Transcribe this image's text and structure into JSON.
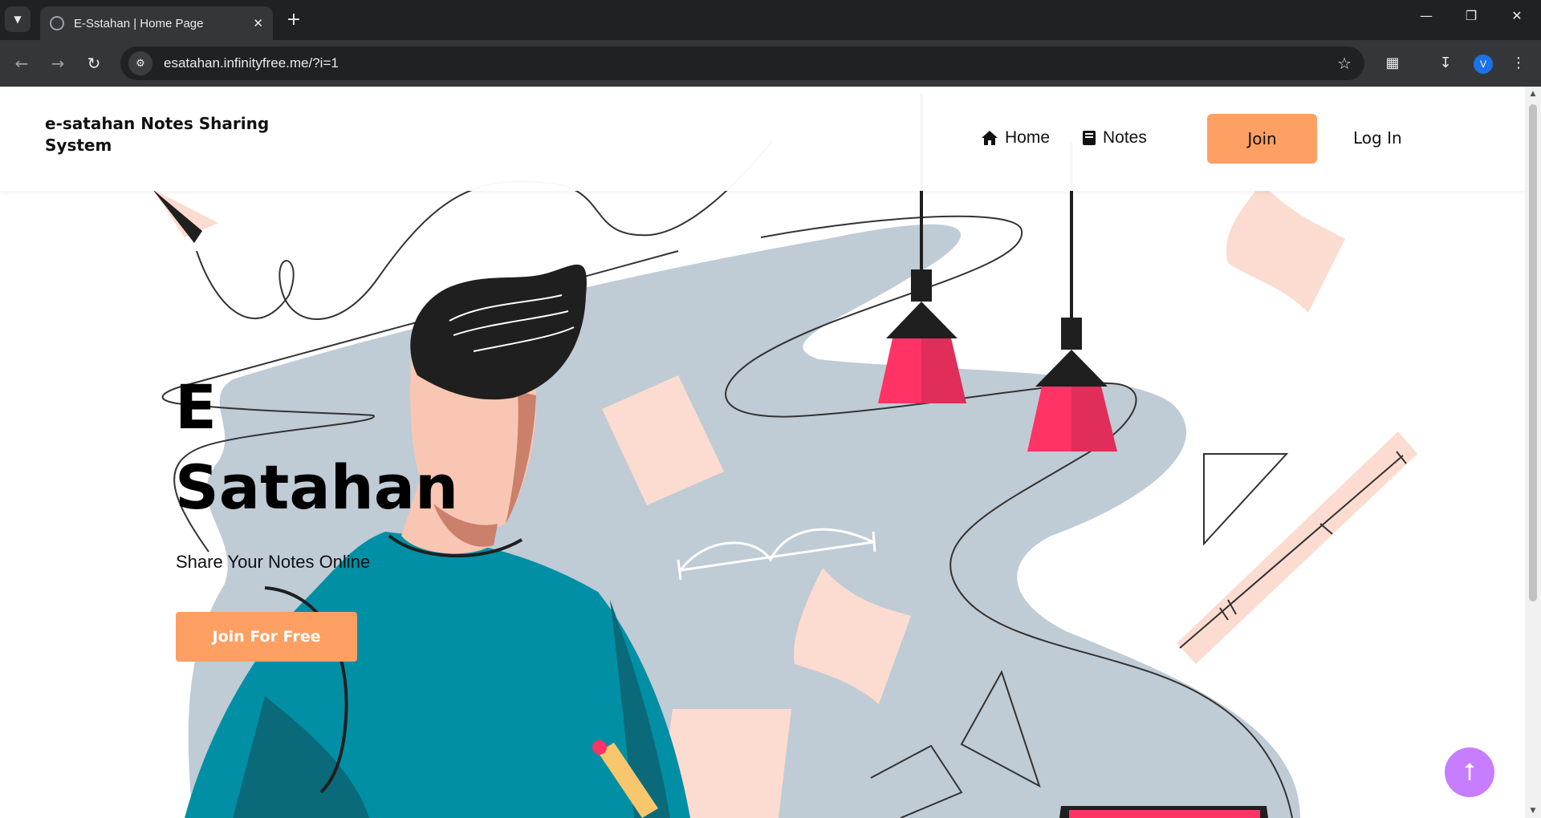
{
  "browser": {
    "tab_title": "E-Sstahan | Home Page",
    "url": "esatahan.infinityfree.me/?i=1",
    "profile_initial": "V"
  },
  "header": {
    "brand": "e-satahan Notes Sharing System",
    "nav": [
      {
        "label": "Home",
        "icon": "home-icon"
      },
      {
        "label": "Notes",
        "icon": "book-icon"
      }
    ],
    "join_label": "Join",
    "login_label": "Log In"
  },
  "hero": {
    "title_line1": "E",
    "title_line2": "Satahan",
    "subtitle": "Share Your Notes Online",
    "cta_label": "Join For Free"
  },
  "colors": {
    "accent": "#fe9f63",
    "scroll_top": "#c77dff",
    "teal": "#018fa5",
    "lamp_red": "#ff3366",
    "blob": "#bfcbd5",
    "peach": "#fcdcd0"
  }
}
